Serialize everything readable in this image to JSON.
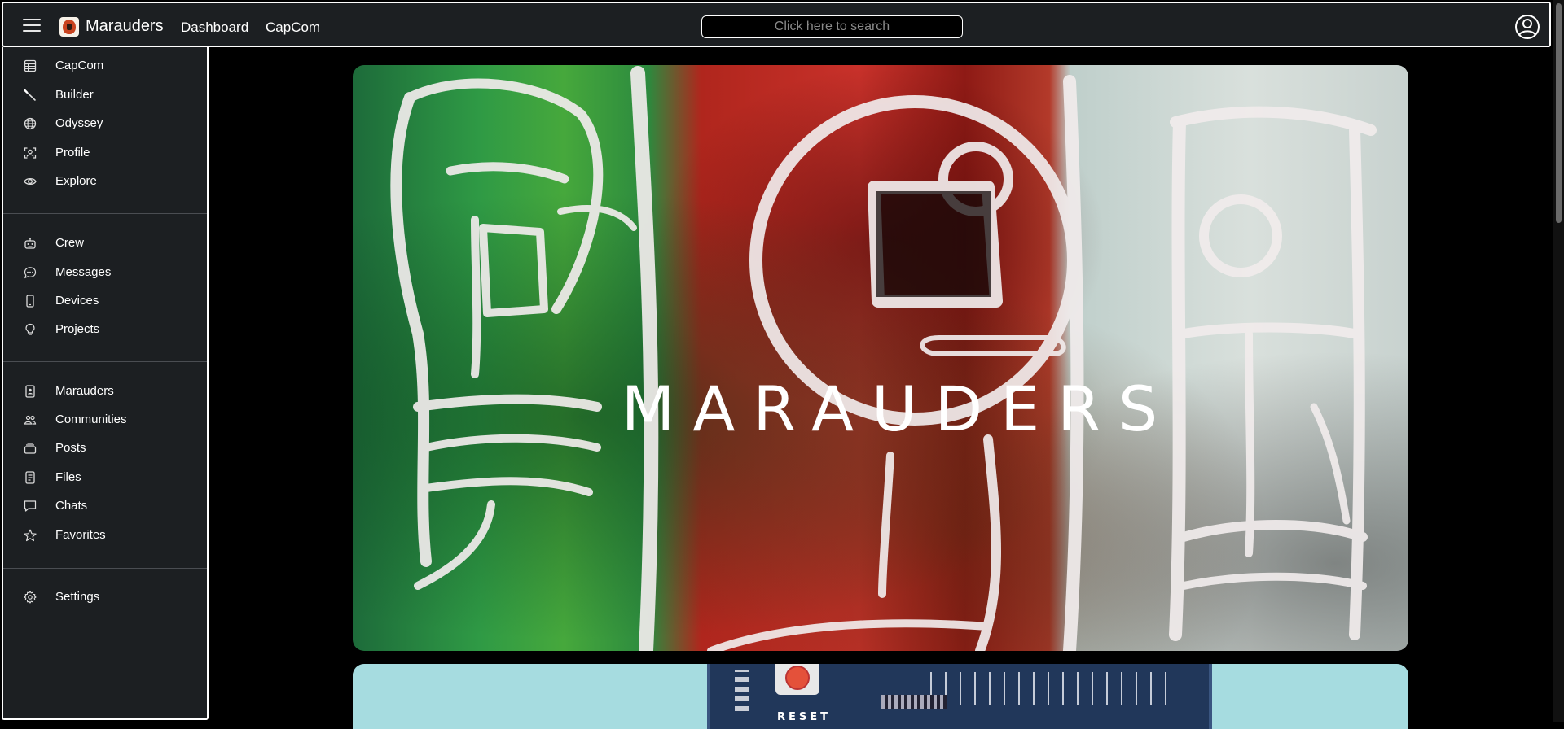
{
  "header": {
    "brand": "Marauders",
    "links": [
      "Dashboard",
      "CapCom"
    ],
    "search_placeholder": "Click here to search"
  },
  "sidebar": {
    "groups": [
      [
        {
          "label": "CapCom",
          "icon": "table-icon"
        },
        {
          "label": "Builder",
          "icon": "wand-icon"
        },
        {
          "label": "Odyssey",
          "icon": "globe-icon"
        },
        {
          "label": "Profile",
          "icon": "person-badge-icon"
        },
        {
          "label": "Explore",
          "icon": "eye-icon"
        }
      ],
      [
        {
          "label": "Crew",
          "icon": "robot-icon"
        },
        {
          "label": "Messages",
          "icon": "chat-dots-icon"
        },
        {
          "label": "Devices",
          "icon": "phone-icon"
        },
        {
          "label": "Projects",
          "icon": "lightbulb-icon"
        }
      ],
      [
        {
          "label": "Marauders",
          "icon": "person-card-icon"
        },
        {
          "label": "Communities",
          "icon": "people-icon"
        },
        {
          "label": "Posts",
          "icon": "cards-icon"
        },
        {
          "label": "Files",
          "icon": "file-icon"
        },
        {
          "label": "Chats",
          "icon": "chat-square-icon"
        },
        {
          "label": "Favorites",
          "icon": "star-icon"
        }
      ],
      [
        {
          "label": "Settings",
          "icon": "gear-icon"
        }
      ]
    ]
  },
  "hero": {
    "title": "MARAUDERS"
  },
  "card2": {
    "button_text": "RESET"
  },
  "colors": {
    "topbar_bg": "#1c1f22",
    "page_bg": "#000000",
    "border": "#ffffff",
    "card2_bg": "#a6dce0"
  }
}
